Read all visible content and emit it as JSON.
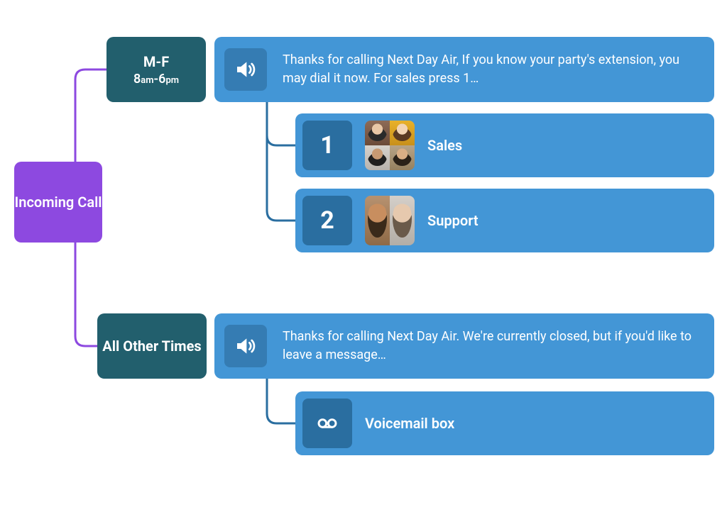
{
  "colors": {
    "incoming_call": "#8d49e0",
    "schedule_block": "#225f6d",
    "flow_block": "#4396d6",
    "inner_square": "#2a6ea0",
    "connector_purple": "#8d49e0",
    "connector_blue": "#2a6ea0"
  },
  "root": {
    "label": "Incoming Call"
  },
  "branches": [
    {
      "id": "business_hours",
      "schedule": {
        "title": "M-F",
        "time_start_num": "8",
        "time_start_unit": "am",
        "time_sep": "-",
        "time_end_num": "6",
        "time_end_unit": "pm"
      },
      "greeting": {
        "icon": "speaker-icon",
        "text": "Thanks for calling Next Day Air, If you know your party's extension, you may dial it now. For sales press 1…"
      },
      "options": [
        {
          "key": "1",
          "label": "Sales",
          "team_avatars": 4
        },
        {
          "key": "2",
          "label": "Support",
          "team_avatars": 2
        }
      ]
    },
    {
      "id": "after_hours",
      "schedule": {
        "title": "All Other Times"
      },
      "greeting": {
        "icon": "speaker-icon",
        "text": "Thanks for calling Next Day Air. We're currently closed, but if you'd like to leave a message…"
      },
      "destination": {
        "icon": "voicemail-icon",
        "label": "Voicemail box"
      }
    }
  ]
}
